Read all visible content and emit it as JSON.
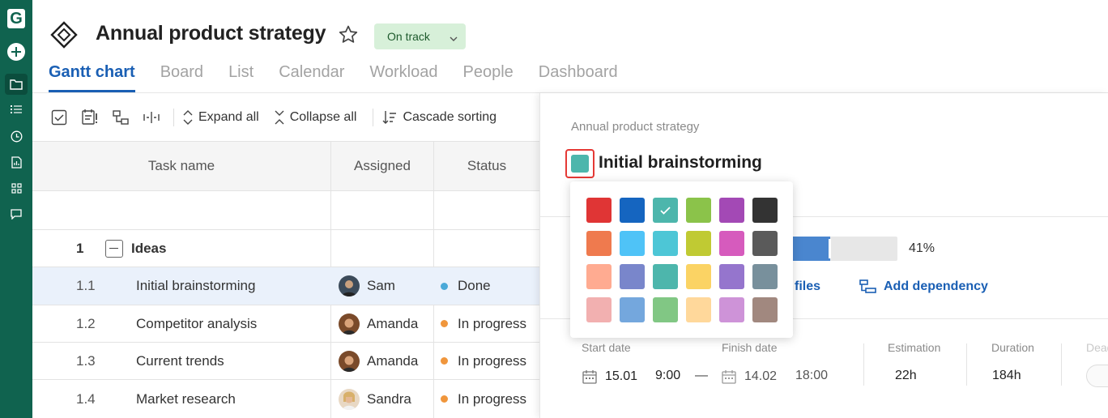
{
  "app": {
    "logo_letter": "G"
  },
  "project": {
    "title": "Annual product strategy",
    "status": "On track"
  },
  "tabs": [
    {
      "label": "Gantt chart",
      "active": true
    },
    {
      "label": "Board"
    },
    {
      "label": "List"
    },
    {
      "label": "Calendar"
    },
    {
      "label": "Workload"
    },
    {
      "label": "People"
    },
    {
      "label": "Dashboard"
    }
  ],
  "toolbar": {
    "expand_all": "Expand all",
    "collapse_all": "Collapse all",
    "cascade_sorting": "Cascade sorting"
  },
  "grid": {
    "headers": {
      "task_name": "Task name",
      "assigned": "Assigned",
      "status": "Status"
    },
    "group": {
      "num": "1",
      "name": "Ideas"
    },
    "rows": [
      {
        "num": "1.1",
        "name": "Initial brainstorming",
        "assignee": "Sam",
        "status": "Done",
        "status_color": "#4aa9d8"
      },
      {
        "num": "1.2",
        "name": "Competitor analysis",
        "assignee": "Amanda",
        "status": "In progress",
        "status_color": "#f0963c"
      },
      {
        "num": "1.3",
        "name": "Current trends",
        "assignee": "Amanda",
        "status": "In progress",
        "status_color": "#f0963c"
      },
      {
        "num": "1.4",
        "name": "Market research",
        "assignee": "Sandra",
        "status": "In progress",
        "status_color": "#f0963c"
      }
    ]
  },
  "panel": {
    "breadcrumb": "Annual product strategy",
    "task_title": "Initial brainstorming",
    "task_color": "#4db6ac",
    "progress": 41,
    "progress_label": "41%",
    "files_link": "files",
    "add_dependency": "Add dependency",
    "labels": {
      "start": "Start date",
      "finish": "Finish date",
      "estimation": "Estimation",
      "duration": "Duration",
      "deadline": "Dead"
    },
    "start_date": "15.01",
    "start_time": "9:00",
    "dash": "—",
    "finish_date": "14.02",
    "finish_time": "18:00",
    "estimation": "22h",
    "duration": "184h"
  },
  "color_picker": {
    "selected": "#4db6ac",
    "colors": [
      "#e03535",
      "#1565c0",
      "#4db6ac",
      "#8bc34a",
      "#a349b5",
      "#333333",
      "#ef7a4e",
      "#4fc3f7",
      "#4dc6d6",
      "#c0ca33",
      "#d65bbd",
      "#5a5a5a",
      "#ffab91",
      "#7986cb",
      "#4db6ac",
      "#fbd364",
      "#9575cd",
      "#78909c",
      "#f2b0b0",
      "#74a7dd",
      "#81c784",
      "#ffd89b",
      "#ce93d8",
      "#a1887f"
    ]
  }
}
